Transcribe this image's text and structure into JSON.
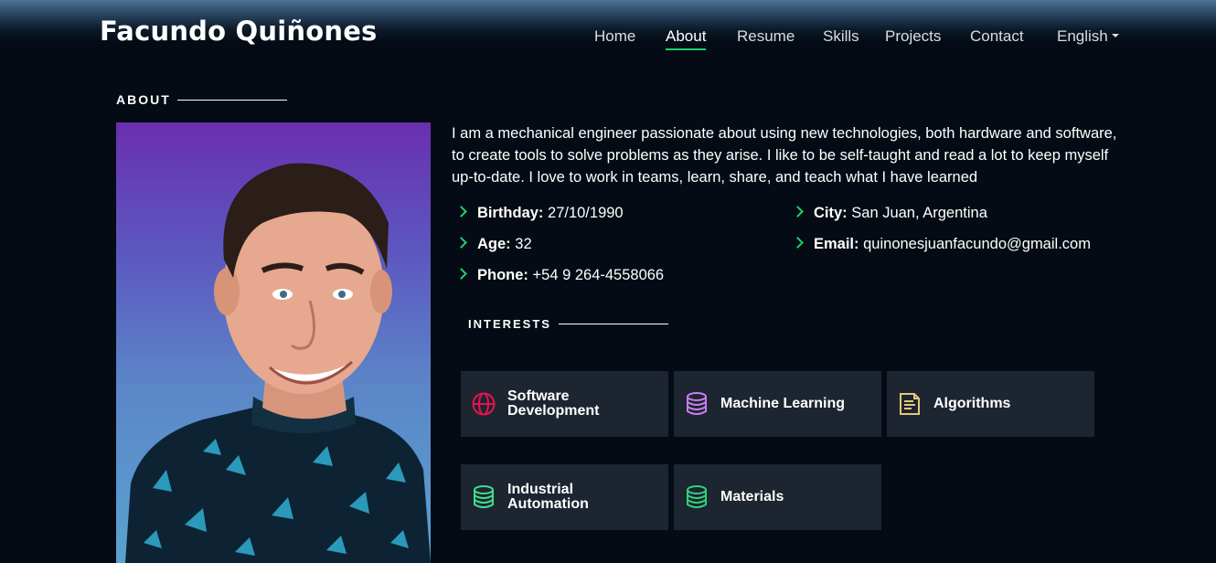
{
  "header": {
    "brand": "Facundo Quiñones",
    "nav": [
      {
        "label": "Home"
      },
      {
        "label": "About",
        "active": true
      },
      {
        "label": "Resume"
      },
      {
        "label": "Skills"
      },
      {
        "label": "Projects"
      },
      {
        "label": "Contact"
      },
      {
        "label": "English"
      }
    ]
  },
  "about": {
    "title": "ABOUT",
    "bio": "I am a mechanical engineer passionate about using new technologies, both hardware and software, to create tools to solve problems as they arise. I like to be self-taught and read a lot to keep myself up-to-date. I love to work in teams, learn, share, and teach what I have learned",
    "info": [
      {
        "label": "Birthday:",
        "value": "27/10/1990"
      },
      {
        "label": "City:",
        "value": "San Juan, Argentina"
      },
      {
        "label": "Age:",
        "value": "32"
      },
      {
        "label": "Email:",
        "value": "quinonesjuanfacundo@gmail.com"
      },
      {
        "label": "Phone:",
        "value": "+54 9 264-4558066"
      }
    ]
  },
  "interests": {
    "title": "INTERESTS",
    "items": [
      {
        "line1": "Software",
        "line2": "Development",
        "icon": "globe-icon",
        "color": "#e5134f"
      },
      {
        "line1": "Machine Learning",
        "line2": "",
        "icon": "database-icon",
        "color": "#c77ef0"
      },
      {
        "line1": "Algorithms",
        "line2": "",
        "icon": "document-icon",
        "color": "#e3c77a"
      },
      {
        "line1": "Industrial",
        "line2": "Automation",
        "icon": "database-icon",
        "color": "#3ee08a"
      },
      {
        "line1": "Materials",
        "line2": "",
        "icon": "database-icon",
        "color": "#2fd27a"
      }
    ]
  },
  "colors": {
    "accent": "#18d26e",
    "background": "#040b14",
    "card": "#1c2530"
  }
}
